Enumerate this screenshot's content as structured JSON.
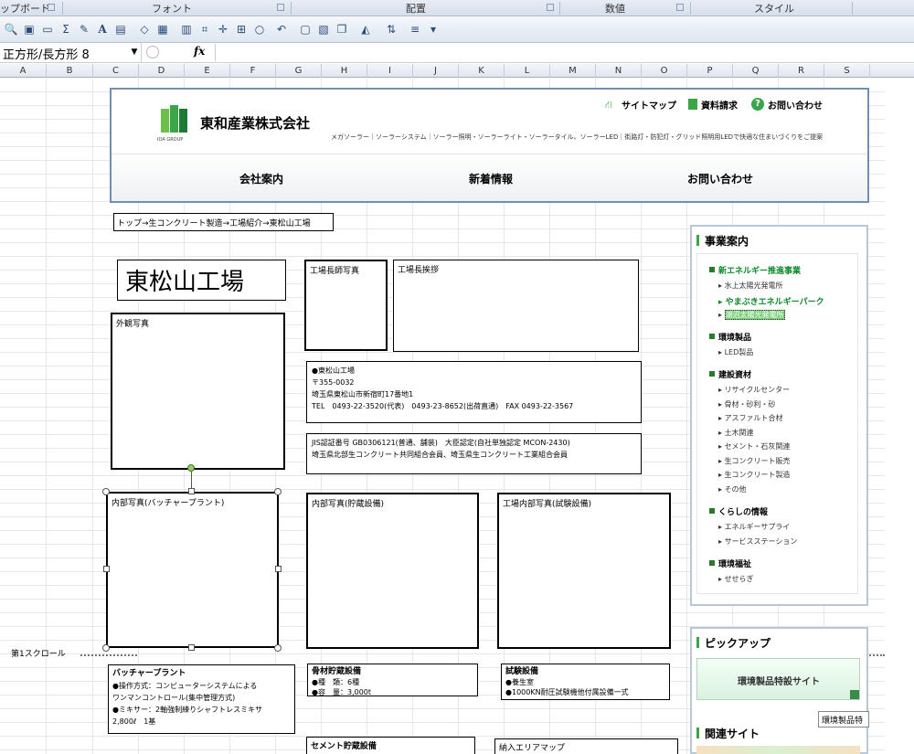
{
  "ribbon": {
    "groups": [
      "ップボード",
      "フォント",
      "配置",
      "数値",
      "スタイル"
    ]
  },
  "formula_bar": {
    "name_box": "正方形/長方形 8",
    "fx_label": "fx",
    "value": ""
  },
  "columns": [
    "A",
    "B",
    "C",
    "D",
    "E",
    "F",
    "G",
    "H",
    "I",
    "J",
    "K",
    "L",
    "M",
    "N",
    "O",
    "P",
    "Q",
    "R",
    "S"
  ],
  "site": {
    "company": "東和産業株式会社",
    "logo_sub": "IOA GROUP",
    "tagline": "メガソーラー｜ソーラーシステム｜ソーラー照明・ソーラーライト・ソーラータイル、ソーラーLED｜街路灯・防犯灯・グリッド照明用LEDで快適な住まいづくりをご提案",
    "top_links": [
      "サイトマップ",
      "資料請求",
      "お問い合わせ"
    ],
    "nav": [
      "会社案内",
      "新着情報",
      "お問い合わせ"
    ]
  },
  "breadcrumb": "トップ→生コンクリート製造→工場紹介→東松山工場",
  "page_title": "東松山工場",
  "photo_labels": {
    "exterior": "外観写真",
    "manager": "工場長師写真",
    "greeting": "工場長挨拶",
    "batcher": "内部写真(バッチャープラント)",
    "storage": "内部写真(貯蔵設備)",
    "testing": "工場内部写真(試験設備)"
  },
  "address": {
    "name": "●東松山工場",
    "zip": "〒355-0032",
    "addr": "埼玉県東松山市新宿町17番地1",
    "tel": "TEL　0493-22-3520(代表)　0493-23-8652(出荷直通)　FAX 0493-22-3567"
  },
  "certification": {
    "line1": "JIS認証番号 GB0306121(普通、舗装)　大臣認定(自社単独認定 MCON-2430)",
    "line2": "埼玉県北部生コンクリート共同組合会員、埼玉県生コンクリート工業組合会員"
  },
  "scroll_label": "第1スクロール",
  "equipment": {
    "batcher": {
      "title": "バッチャープラント",
      "l1": "●操作方式：コンピューターシステムによる",
      "l2": "ワンマンコントロール(集中管理方式)",
      "l3": "●ミキサー：2軸強制練りシャフトレスミキサ",
      "l4": "2,800ℓ　1基"
    },
    "aggregate": {
      "title": "骨材貯蔵設備",
      "l1": "●種　類：6種",
      "l2": "●容　量：3,000t"
    },
    "test": {
      "title": "試験設備",
      "l1": "●養生室",
      "l2": "●1000KN耐圧試験機他付属設備一式"
    },
    "cement": {
      "title": "セメント貯蔵設備"
    },
    "delivery": {
      "title": "納入エリアマップ"
    }
  },
  "sidebar": {
    "title": "事業案内",
    "sections": [
      {
        "cat": "新エネルギー推進事業",
        "items": [
          "水上太陽光発電所",
          "やまぶきエネルギーパーク",
          "湖沼太陽光発電所"
        ]
      },
      {
        "cat": "環境製品",
        "items": [
          "LED製品"
        ]
      },
      {
        "cat": "建設資材",
        "items": [
          "リサイクルセンター",
          "骨材・砂利・砂",
          "アスファルト合材",
          "土木関連",
          "セメント・石灰関連",
          "生コンクリート販売",
          "生コンクリート製造",
          "その他"
        ]
      },
      {
        "cat": "くらしの情報",
        "items": [
          "エネルギーサプライ",
          "サービスステーション"
        ]
      },
      {
        "cat": "環境福祉",
        "items": [
          "せせらぎ"
        ]
      }
    ]
  },
  "pickup": {
    "title": "ピックアップ",
    "banner": "環境製品特設サイト",
    "tooltip": "環境製品特",
    "related": "関連サイト"
  },
  "colors": {
    "accent_green": "#3aa648",
    "header_border": "#6f8fb8"
  }
}
